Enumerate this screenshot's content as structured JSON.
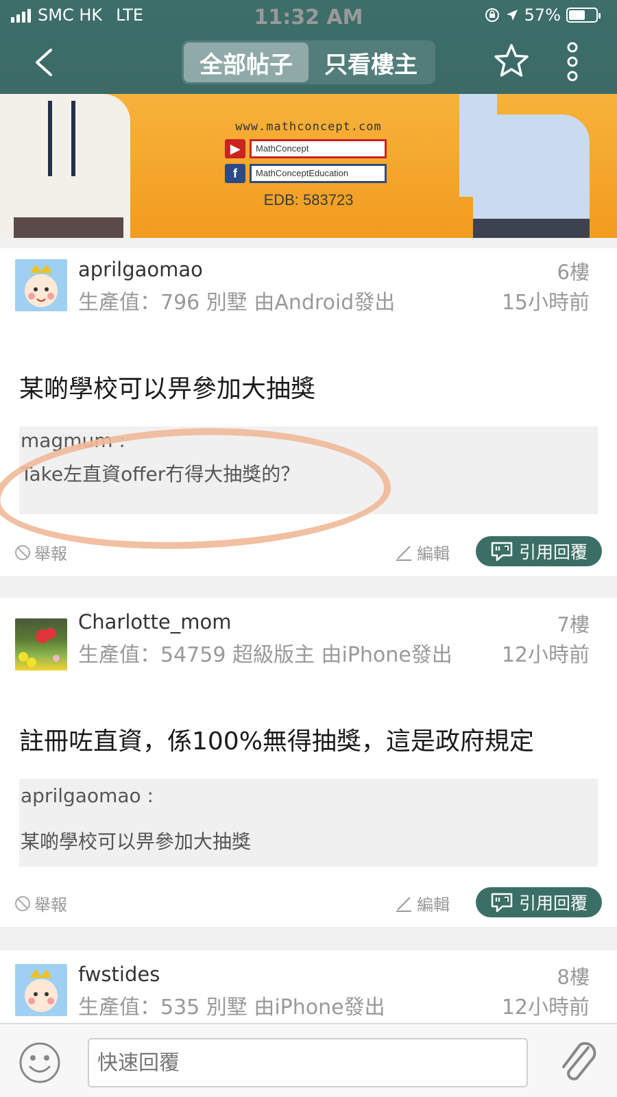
{
  "status_bar": {
    "carrier": "SMC HK",
    "network": "LTE",
    "time": "11:32 AM",
    "battery": "57%"
  },
  "nav": {
    "tabs": [
      {
        "label": "全部帖子",
        "active": true
      },
      {
        "label": "只看樓主",
        "active": false
      }
    ],
    "icons": [
      "back-icon",
      "star-icon",
      "more-icon"
    ]
  },
  "banner": {
    "url": "www.mathconcept.com",
    "youtube": "MathConcept",
    "facebook": "MathConceptEducation",
    "edb": "EDB: 583723"
  },
  "posts": [
    {
      "username": "aprilgaomao",
      "meta": "生產值：796 別墅 由Android發出",
      "floor": "6樓",
      "time": "15小時前",
      "content": "某啲學校可以畀參加大抽獎",
      "quote_user": "magmum :",
      "quote_text": "Take左直資offer冇得大抽獎的？",
      "report": "舉報",
      "edit": "編輯",
      "reply": "引用回覆"
    },
    {
      "username": "Charlotte_mom",
      "meta": "生產值：54759 超級版主 由iPhone發出",
      "floor": "7樓",
      "time": "12小時前",
      "content": "註冊咗直資，係100%無得抽獎，這是政府規定",
      "quote_user": "aprilgaomao :",
      "quote_text": "某啲學校可以畀參加大抽獎",
      "report": "舉報",
      "edit": "編輯",
      "reply": "引用回覆"
    },
    {
      "username": "fwstides",
      "meta": "生產值：535 別墅 由iPhone發出",
      "floor": "8樓",
      "time": "12小時前"
    }
  ],
  "bottom": {
    "placeholder": "快速回覆"
  },
  "colors": {
    "nav_bg": "#3d6e6a",
    "reply_button": "#3b6f66",
    "annotation_circle": "#f0b898"
  }
}
